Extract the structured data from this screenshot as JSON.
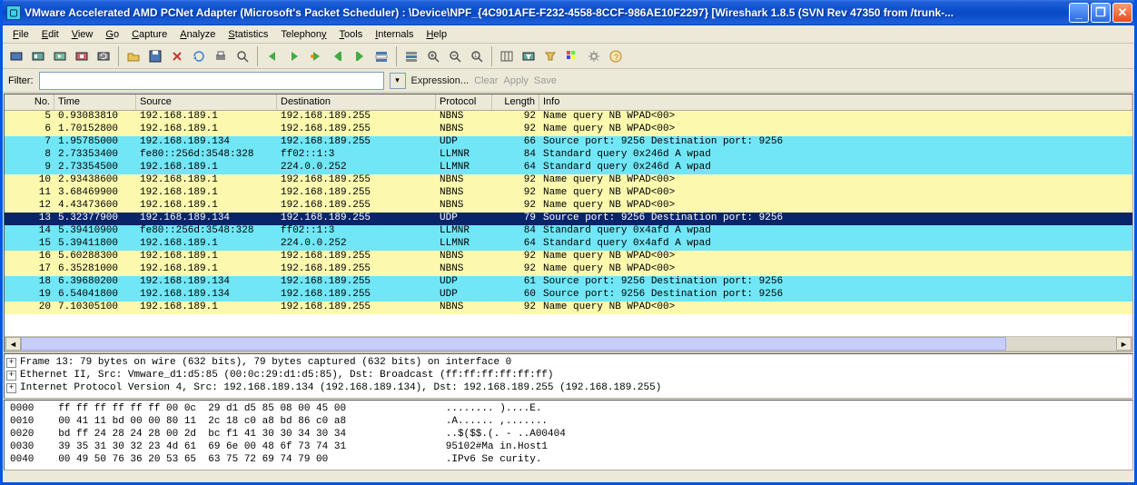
{
  "title": "VMware Accelerated AMD PCNet Adapter (Microsoft's Packet Scheduler) : \\Device\\NPF_{4C901AFE-F232-4558-8CCF-986AE10F2297}   [Wireshark 1.8.5  (SVN Rev 47350 from /trunk-...",
  "menu": [
    "File",
    "Edit",
    "View",
    "Go",
    "Capture",
    "Analyze",
    "Statistics",
    "Telephony",
    "Tools",
    "Internals",
    "Help"
  ],
  "filter": {
    "label": "Filter:",
    "value": "",
    "expression": "Expression...",
    "clear": "Clear",
    "apply": "Apply",
    "save": "Save"
  },
  "columns": {
    "no": "No.",
    "time": "Time",
    "source": "Source",
    "destination": "Destination",
    "protocol": "Protocol",
    "length": "Length",
    "info": "Info"
  },
  "packets": [
    {
      "no": "5",
      "time": "0.93083810",
      "src": "192.168.189.1",
      "dst": "192.168.189.255",
      "proto": "NBNS",
      "len": "92",
      "info": "Name query NB WPAD<00>",
      "cls": "yellow"
    },
    {
      "no": "6",
      "time": "1.70152800",
      "src": "192.168.189.1",
      "dst": "192.168.189.255",
      "proto": "NBNS",
      "len": "92",
      "info": "Name query NB WPAD<00>",
      "cls": "yellow"
    },
    {
      "no": "7",
      "time": "1.95785000",
      "src": "192.168.189.134",
      "dst": "192.168.189.255",
      "proto": "UDP",
      "len": "66",
      "info": "Source port: 9256  Destination port: 9256",
      "cls": "cyan"
    },
    {
      "no": "8",
      "time": "2.73353400",
      "src": "fe80::256d:3548:328",
      "dst": "ff02::1:3",
      "proto": "LLMNR",
      "len": "84",
      "info": "Standard query 0x246d  A wpad",
      "cls": "cyan"
    },
    {
      "no": "9",
      "time": "2.73354500",
      "src": "192.168.189.1",
      "dst": "224.0.0.252",
      "proto": "LLMNR",
      "len": "64",
      "info": "Standard query 0x246d  A wpad",
      "cls": "cyan"
    },
    {
      "no": "10",
      "time": "2.93438600",
      "src": "192.168.189.1",
      "dst": "192.168.189.255",
      "proto": "NBNS",
      "len": "92",
      "info": "Name query NB WPAD<00>",
      "cls": "yellow"
    },
    {
      "no": "11",
      "time": "3.68469900",
      "src": "192.168.189.1",
      "dst": "192.168.189.255",
      "proto": "NBNS",
      "len": "92",
      "info": "Name query NB WPAD<00>",
      "cls": "yellow"
    },
    {
      "no": "12",
      "time": "4.43473600",
      "src": "192.168.189.1",
      "dst": "192.168.189.255",
      "proto": "NBNS",
      "len": "92",
      "info": "Name query NB WPAD<00>",
      "cls": "yellow"
    },
    {
      "no": "13",
      "time": "5.32377900",
      "src": "192.168.189.134",
      "dst": "192.168.189.255",
      "proto": "UDP",
      "len": "79",
      "info": "Source port: 9256  Destination port: 9256",
      "cls": "selected"
    },
    {
      "no": "14",
      "time": "5.39410900",
      "src": "fe80::256d:3548:328",
      "dst": "ff02::1:3",
      "proto": "LLMNR",
      "len": "84",
      "info": "Standard query 0x4afd  A wpad",
      "cls": "cyan"
    },
    {
      "no": "15",
      "time": "5.39411800",
      "src": "192.168.189.1",
      "dst": "224.0.0.252",
      "proto": "LLMNR",
      "len": "64",
      "info": "Standard query 0x4afd  A wpad",
      "cls": "cyan"
    },
    {
      "no": "16",
      "time": "5.60288300",
      "src": "192.168.189.1",
      "dst": "192.168.189.255",
      "proto": "NBNS",
      "len": "92",
      "info": "Name query NB WPAD<00>",
      "cls": "yellow"
    },
    {
      "no": "17",
      "time": "6.35281000",
      "src": "192.168.189.1",
      "dst": "192.168.189.255",
      "proto": "NBNS",
      "len": "92",
      "info": "Name query NB WPAD<00>",
      "cls": "yellow"
    },
    {
      "no": "18",
      "time": "6.39680200",
      "src": "192.168.189.134",
      "dst": "192.168.189.255",
      "proto": "UDP",
      "len": "61",
      "info": "Source port: 9256  Destination port: 9256",
      "cls": "cyan"
    },
    {
      "no": "19",
      "time": "6.54041800",
      "src": "192.168.189.134",
      "dst": "192.168.189.255",
      "proto": "UDP",
      "len": "60",
      "info": "Source port: 9256  Destination port: 9256",
      "cls": "cyan"
    },
    {
      "no": "20",
      "time": "7.10305100",
      "src": "192.168.189.1",
      "dst": "192.168.189.255",
      "proto": "NBNS",
      "len": "92",
      "info": "Name query NB WPAD<00>",
      "cls": "yellow"
    }
  ],
  "details": [
    "Frame 13: 79 bytes on wire (632 bits), 79 bytes captured (632 bits) on interface 0",
    "Ethernet II, Src: Vmware_d1:d5:85 (00:0c:29:d1:d5:85), Dst: Broadcast (ff:ff:ff:ff:ff:ff)",
    "Internet Protocol Version 4, Src: 192.168.189.134 (192.168.189.134), Dst: 192.168.189.255 (192.168.189.255)"
  ],
  "hex": [
    {
      "off": "0000",
      "b": "ff ff ff ff ff ff 00 0c  29 d1 d5 85 08 00 45 00",
      "a": "........ )....E."
    },
    {
      "off": "0010",
      "b": "00 41 11 bd 00 00 80 11  2c 18 c0 a8 bd 86 c0 a8",
      "a": ".A...... ,......."
    },
    {
      "off": "0020",
      "b": "bd ff 24 28 24 28 00 2d  bc f1 41 30 30 34 30 34",
      "a": "..$($$.(. - ..A00404"
    },
    {
      "off": "0030",
      "b": "39 35 31 30 32 23 4d 61  69 6e 00 48 6f 73 74 31",
      "a": "95102#Ma in.Host1"
    },
    {
      "off": "0040",
      "b": "00 49 50 76 36 20 53 65  63 75 72 69 74 79 00",
      "a": ".IPv6 Se curity."
    }
  ],
  "icons": [
    "interfaces",
    "options",
    "start",
    "stop",
    "restart",
    "open",
    "save",
    "close",
    "reload",
    "print",
    "find",
    "back",
    "forward",
    "jump",
    "first",
    "last",
    "colorize",
    "autoscroll",
    "zoom-in",
    "zoom-out",
    "zoom-reset",
    "resize",
    "capture-filter",
    "display-filter",
    "coloring",
    "prefs",
    "help"
  ]
}
